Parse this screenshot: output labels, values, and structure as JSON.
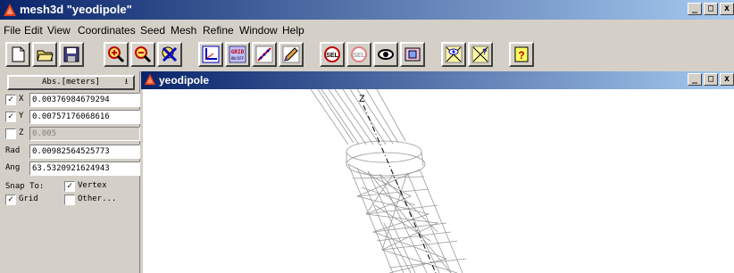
{
  "app": {
    "title": "mesh3d \"yeodipole\""
  },
  "window_buttons": {
    "minimize": "_",
    "maximize": "□",
    "close": "x"
  },
  "menu": [
    {
      "label": "File"
    },
    {
      "label": "Edit"
    },
    {
      "label": "View"
    },
    {
      "label": "Coordinates"
    },
    {
      "label": "Seed"
    },
    {
      "label": "Mesh"
    },
    {
      "label": "Refine"
    },
    {
      "label": "Window"
    },
    {
      "label": "Help"
    }
  ],
  "toolbar": {
    "grid_label_top": "GRID",
    "grid_label_bottom": "ON/OFF",
    "sel_label": "SEL",
    "help_label": "?"
  },
  "left_panel": {
    "units": "Abs.[meters]",
    "x": {
      "label": "X",
      "checked": true,
      "value": "0.00376984679294"
    },
    "y": {
      "label": "Y",
      "checked": true,
      "value": "0.00757176068616"
    },
    "z": {
      "label": "Z",
      "checked": false,
      "value": "0.005"
    },
    "rad": {
      "label": "Rad",
      "value": "0.00982564525773"
    },
    "ang": {
      "label": "Ang",
      "value": "63.5320921624943"
    },
    "snap_to_label": "Snap To:",
    "snap_vertex": {
      "label": "Vertex",
      "checked": true
    },
    "snap_grid": {
      "label": "Grid",
      "checked": true
    },
    "snap_other": {
      "label": "Other...",
      "checked": false
    }
  },
  "child_window": {
    "title": "yeodipole",
    "axis_label": "Z"
  },
  "colors": {
    "titlebar_start": "#0a246a",
    "titlebar_end": "#a6caf0",
    "face": "#d4d0c8",
    "mesh_line": "#9a9a9a"
  }
}
